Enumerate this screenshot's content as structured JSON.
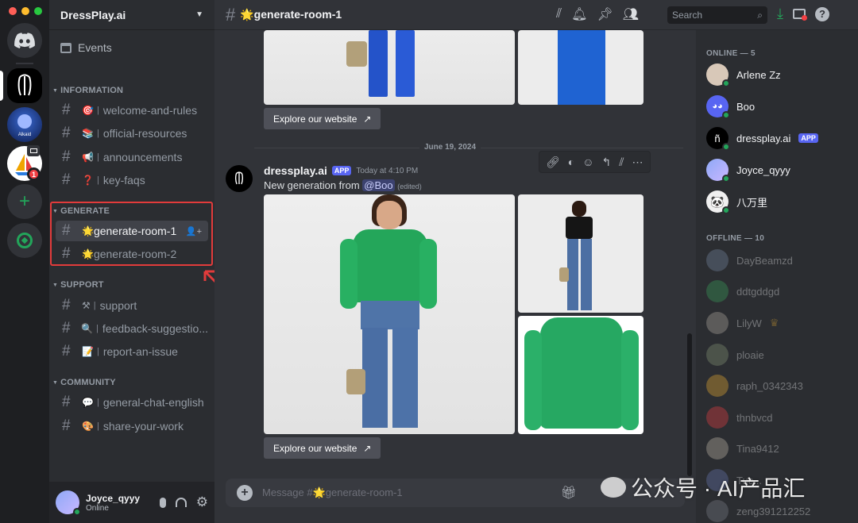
{
  "colors": {
    "blurple": "#5865f2",
    "red": "#f23f43",
    "green": "#23a55a",
    "highlight": "#e23b3b"
  },
  "rail": {
    "servers": [
      {
        "name": "discord-home"
      },
      {
        "name": "dressplay"
      },
      {
        "name": "alkaid",
        "label": "Alkaid"
      },
      {
        "name": "sailboat",
        "badge": "1"
      },
      {
        "name": "add-server"
      },
      {
        "name": "explore"
      }
    ]
  },
  "guild": {
    "name": "DressPlay.ai",
    "events_label": "Events"
  },
  "categories": {
    "information": {
      "label": "INFORMATION",
      "channels": [
        {
          "emoji": "🎯",
          "name": "welcome-and-rules"
        },
        {
          "emoji": "📚",
          "name": "official-resources"
        },
        {
          "emoji": "📢",
          "name": "announcements"
        },
        {
          "emoji": "❓",
          "name": "key-faqs"
        }
      ]
    },
    "generate": {
      "label": "GENERATE",
      "channels": [
        {
          "emoji": "🌟",
          "name": "generate-room-1"
        },
        {
          "emoji": "🌟",
          "name": "generate-room-2"
        }
      ]
    },
    "support": {
      "label": "SUPPORT",
      "channels": [
        {
          "emoji": "⚒",
          "name": "support"
        },
        {
          "emoji": "🔍",
          "name": "feedback-suggestio..."
        },
        {
          "emoji": "📝",
          "name": "report-an-issue"
        }
      ]
    },
    "community": {
      "label": "COMMUNITY",
      "channels": [
        {
          "emoji": "💬",
          "name": "general-chat-english"
        },
        {
          "emoji": "🎨",
          "name": "share-your-work"
        }
      ]
    }
  },
  "user": {
    "name": "Joyce_qyyy",
    "status": "Online"
  },
  "header": {
    "channel": "🌟generate-room-1",
    "search_placeholder": "Search"
  },
  "chat": {
    "button_label": "Explore our website",
    "date_divider": "June 19, 2024",
    "message": {
      "author": "dressplay.ai",
      "tag": "APP",
      "time": "Today at 4:10 PM",
      "text": "New generation from",
      "mention": "@Boo",
      "edited": "(edited)"
    },
    "composer_placeholder": "Message #🌟generate-room-1"
  },
  "members": {
    "online_header": "ONLINE — 5",
    "offline_header": "OFFLINE — 10",
    "online": [
      {
        "name": "Arlene Zz"
      },
      {
        "name": "Boo"
      },
      {
        "name": "dressplay.ai",
        "tag": "APP"
      },
      {
        "name": "Joyce_qyyy"
      },
      {
        "name": "八万里"
      }
    ],
    "offline": [
      {
        "name": "DayBeamzd"
      },
      {
        "name": "ddtgddgd"
      },
      {
        "name": "LilyW",
        "crown": "♛"
      },
      {
        "name": "ploaie"
      },
      {
        "name": "raph_0342343"
      },
      {
        "name": "thnbvcd"
      },
      {
        "name": "Tina9412"
      },
      {
        "name": "Tuc..."
      },
      {
        "name": "zeng391212252"
      }
    ]
  },
  "watermark": {
    "text": "公众号 · AI产品汇"
  }
}
